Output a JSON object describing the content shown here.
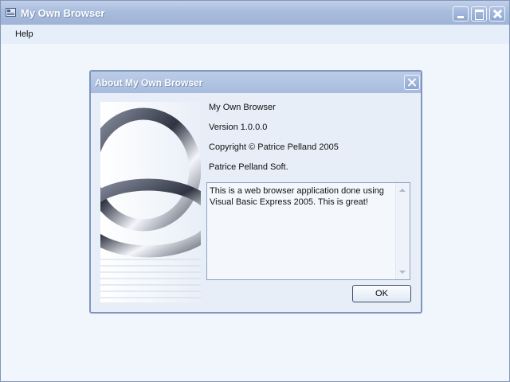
{
  "window": {
    "title": "My Own Browser",
    "icon": "app-window-icon",
    "controls": [
      "minimize-icon",
      "maximize-icon",
      "close-icon"
    ]
  },
  "menubar": {
    "items": [
      {
        "label": "Help"
      }
    ]
  },
  "about_dialog": {
    "title": "About My Own Browser",
    "product_name": "My Own Browser",
    "version": "Version 1.0.0.0",
    "copyright": "Copyright © Patrice Pelland 2005",
    "company": "Patrice Pelland Soft.",
    "description": "This is a web browser application done using Visual Basic Express 2005. This is great!",
    "ok_label": "OK",
    "logo": "interlocking-rings-logo"
  },
  "colors": {
    "titlebar": "#a9bcdd",
    "client_bg": "#f1f6fd",
    "dialog_bg": "#e7eef8",
    "border": "#7f96bd"
  }
}
